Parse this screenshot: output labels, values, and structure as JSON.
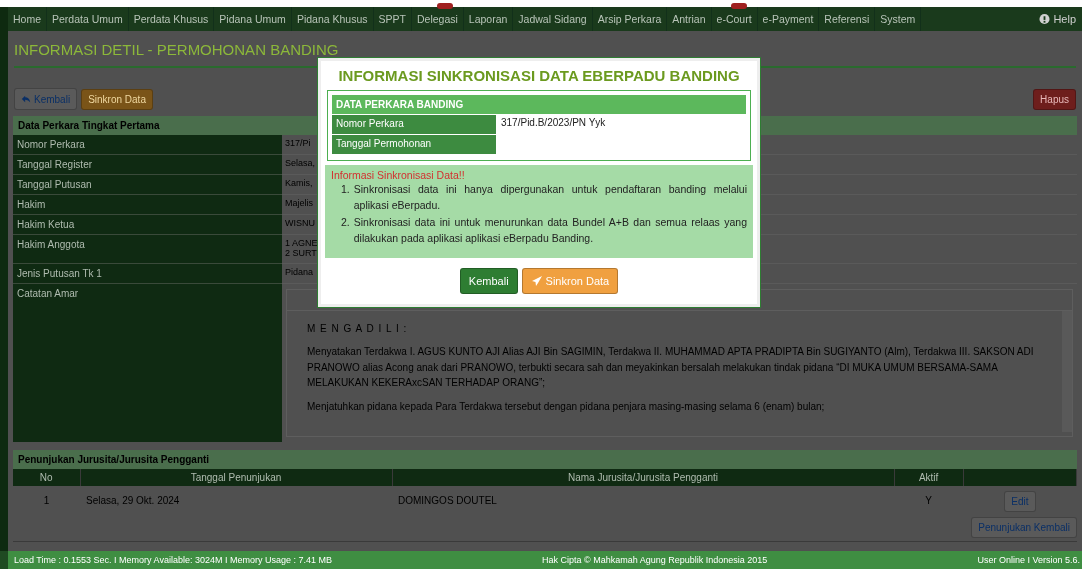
{
  "nav": {
    "items": [
      {
        "label": "Home",
        "badge": false
      },
      {
        "label": "Perdata Umum",
        "badge": false
      },
      {
        "label": "Perdata Khusus",
        "badge": false
      },
      {
        "label": "Pidana Umum",
        "badge": false
      },
      {
        "label": "Pidana Khusus",
        "badge": false
      },
      {
        "label": "SPPT",
        "badge": false
      },
      {
        "label": "Delegasi",
        "badge": true
      },
      {
        "label": "Laporan",
        "badge": false
      },
      {
        "label": "Jadwal Sidang",
        "badge": false
      },
      {
        "label": "Arsip Perkara",
        "badge": false
      },
      {
        "label": "Antrian",
        "badge": false
      },
      {
        "label": "e-Court",
        "badge": true
      },
      {
        "label": "e-Payment",
        "badge": false
      },
      {
        "label": "Referensi",
        "badge": false
      },
      {
        "label": "System",
        "badge": false
      }
    ],
    "help": "Help"
  },
  "page_title": "INFORMASI DETIL - PERMOHONAN BANDING",
  "toolbar": {
    "back": "Kembali",
    "sync": "Sinkron Data",
    "delete": "Hapus"
  },
  "first_level": {
    "title": "Data Perkara Tingkat Pertama",
    "rows": [
      {
        "label": "Nomor Perkara",
        "value": "317/Pi"
      },
      {
        "label": "Tanggal Register",
        "value": "Selasa,"
      },
      {
        "label": "Tanggal Putusan",
        "value": "Kamis,"
      },
      {
        "label": "Hakim",
        "value": "Majelis"
      },
      {
        "label": "Hakim Ketua",
        "value": "WISNU"
      },
      {
        "label": "Hakim Anggota",
        "value": "1 AGNE\n2 SURT"
      },
      {
        "label": "Jenis Putusan Tk 1",
        "value": "Pidana"
      }
    ],
    "amar_label": "Catatan Amar",
    "amar": {
      "heading": "M E N G A D I L I :",
      "paragraphs": [
        "Menyatakan Terdakwa I. AGUS KUNTO AJI Alias AJI Bin SAGIMIN, Terdakwa II. MUHAMMAD APTA PRADIPTA Bin SUGIYANTO (Alm), Terdakwa III. SAKSON ADI PRANOWO alias Acong anak dari PRANOWO, terbukti secara sah dan meyakinkan bersalah melakukan tindak pidana “DI MUKA UMUM  BERSAMA-SAMA MELAKUKAN KEKERAxcSAN TERHADAP ORANG”;",
        "Menjatuhkan pidana kepada Para Terdakwa tersebut dengan pidana penjara masing-masing selama 6 (enam) bulan;"
      ]
    }
  },
  "bailiff": {
    "title": "Penunjukan Jurusita/Jurusita Pengganti",
    "columns": [
      "No",
      "Tanggal Penunjukan",
      "Nama Jurusita/Jurusita Pengganti",
      "Aktif"
    ],
    "rows": [
      {
        "no": "1",
        "date": "Selasa, 29 Okt. 2024",
        "name": "DOMINGOS DOUTEL",
        "active": "Y",
        "action": "Edit"
      }
    ],
    "reassign": "Penunjukan Kembali"
  },
  "footer": {
    "left": "Load Time : 0.1553 Sec. I Memory Available: 3024M I Memory Usage : 7.41 MB",
    "center": "Hak Cipta © Mahkamah Agung Republik Indonesia 2015",
    "right": "User Online I Version 5.6."
  },
  "modal": {
    "title": "INFORMASI SINKRONISASI DATA EBERPADU BANDING",
    "table_title": "DATA PERKARA BANDING",
    "rows": [
      {
        "label": "Nomor Perkara",
        "value": "317/Pid.B/2023/PN Yyk"
      },
      {
        "label": "Tanggal Permohonan",
        "value": ""
      }
    ],
    "info_title": "Informasi Sinkronisasi Data!!",
    "info_items": [
      {
        "marker": "1.",
        "text": "Sinkronisasi data ini hanya dipergunakan untuk pendaftaran banding melalui aplikasi eBerpadu."
      },
      {
        "marker": "2.",
        "text": "Sinkronisasi data ini untuk menurunkan data Bundel A+B dan semua relaas yang dilakukan pada aplikasi aplikasi eBerpadu Banding."
      }
    ],
    "back": "Kembali",
    "sync": "Sinkron Data"
  }
}
